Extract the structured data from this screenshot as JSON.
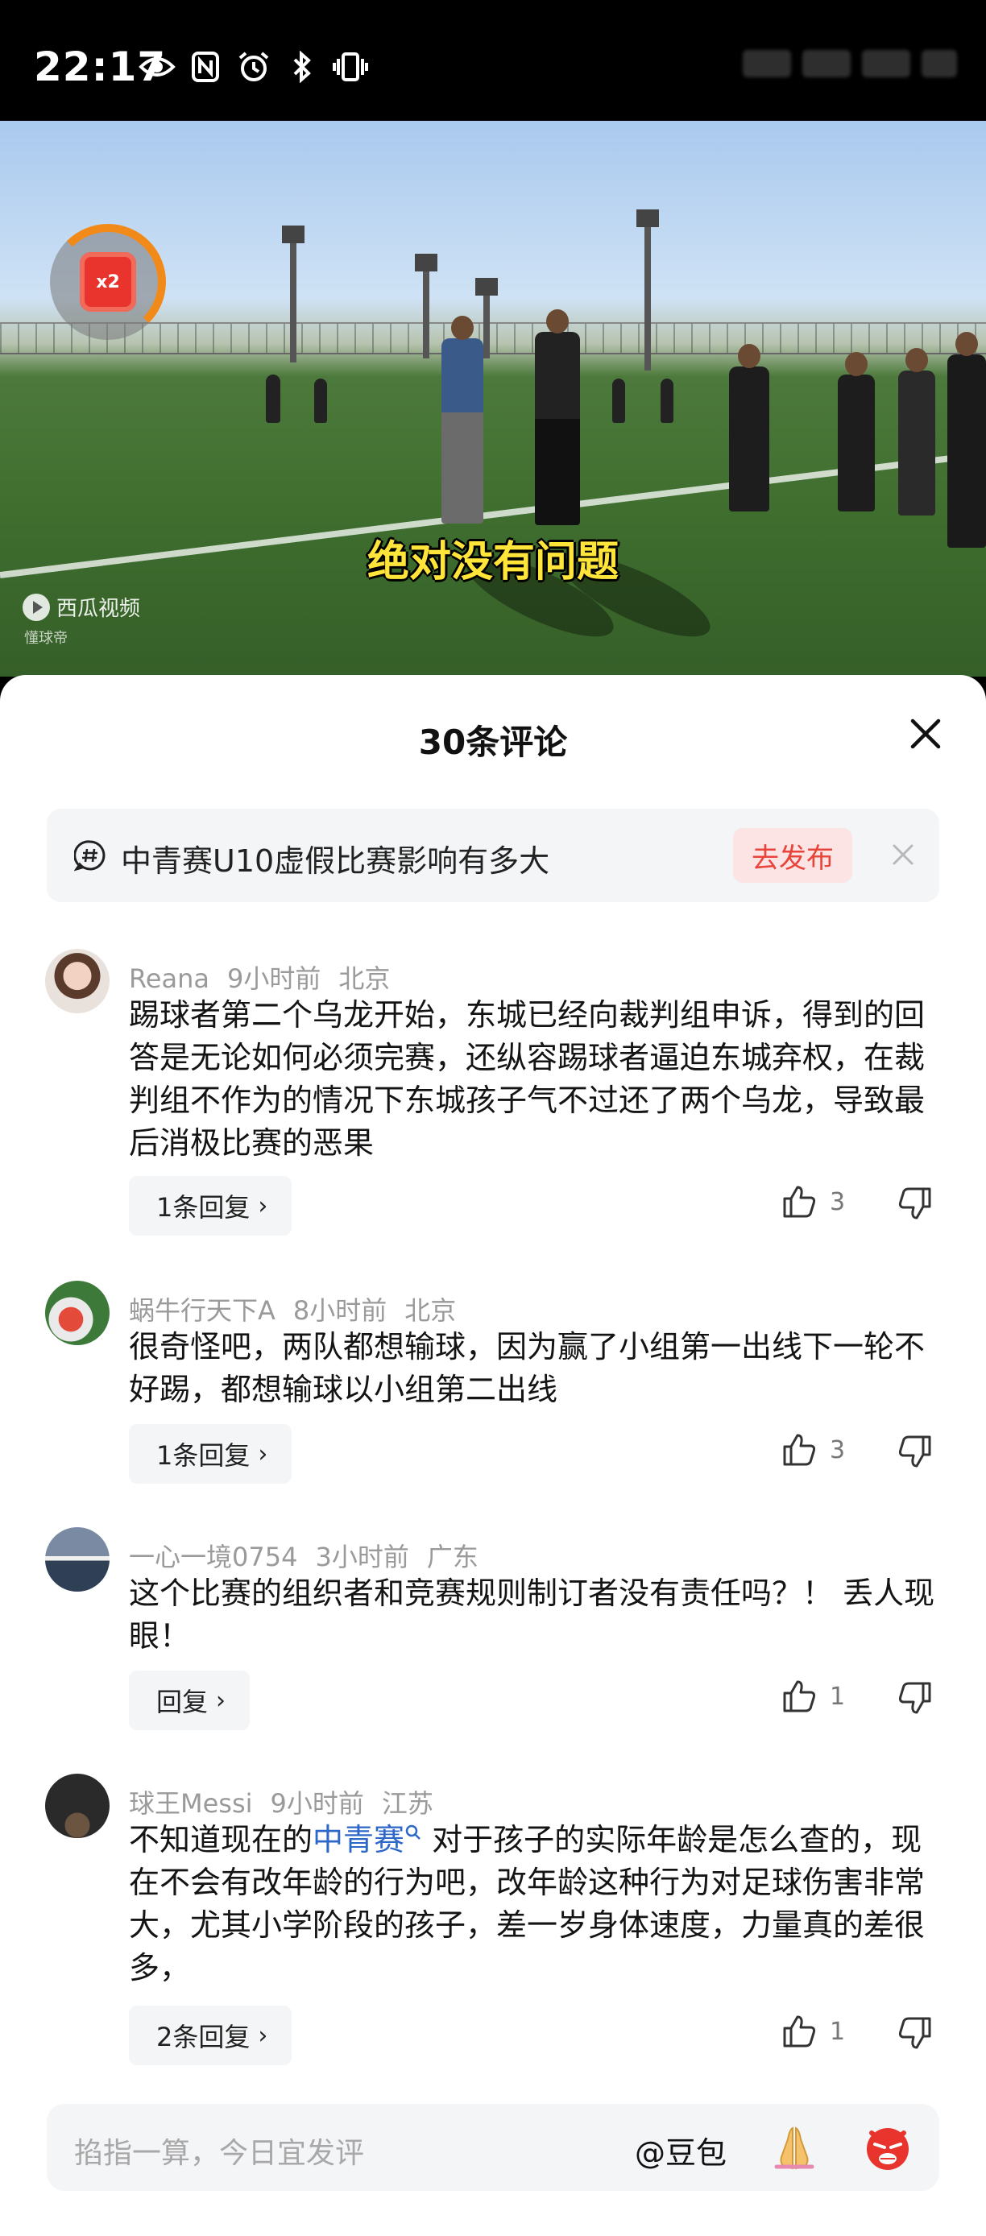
{
  "status_bar": {
    "time": "22:17"
  },
  "video": {
    "subtitle": "绝对没有问题",
    "watermark": "西瓜视频",
    "watermark_sub": "懂球帝",
    "speed_badge": "x2"
  },
  "sheet": {
    "title": "30条评论",
    "topic": {
      "text": "中青赛U10虚假比赛影响有多大",
      "publish_label": "去发布"
    },
    "comments": [
      {
        "user": "Reana",
        "time": "9小时前",
        "location": "北京",
        "text": "踢球者第二个乌龙开始，东城已经向裁判组申诉，得到的回答是无论如何必须完赛，还纵容踢球者逼迫东城弃权，在裁判组不作为的情况下东城孩子气不过还了两个乌龙，导致最后消极比赛的恶果",
        "reply_label": "1条回复",
        "likes": "3"
      },
      {
        "user": "蜗牛行天下A",
        "time": "8小时前",
        "location": "北京",
        "text": "很奇怪吧，两队都想输球，因为赢了小组第一出线下一轮不好踢，都想输球以小组第二出线",
        "reply_label": "1条回复",
        "likes": "3"
      },
      {
        "user": "一心一境0754",
        "time": "3小时前",
        "location": "广东",
        "text": "这个比赛的组织者和竞赛规则制订者没有责任吗？！ 丢人现眼！",
        "reply_label": "回复",
        "likes": "1"
      },
      {
        "user": "球王Messi",
        "time": "9小时前",
        "location": "江苏",
        "text_before": "不知道现在的",
        "text_link": "中青赛",
        "text_after": " 对于孩子的实际年龄是怎么查的，现在不会有改年龄的行为吧，改年龄这种行为对足球伤害非常大，尤其小学阶段的孩子，差一岁身体速度，力量真的差很多，",
        "reply_label": "2条回复",
        "likes": "1"
      }
    ]
  },
  "input_bar": {
    "placeholder": "掐指一算，今日宜发评",
    "at_label": "@豆包"
  },
  "colors": {
    "accent_red": "#e8443a",
    "link_blue": "#2d67c8",
    "publish_bg": "#fde4e4"
  },
  "icons": [
    "eye-icon",
    "nfc-icon",
    "alarm-icon",
    "bluetooth-icon",
    "vibrate-icon",
    "hashtag-icon",
    "close-icon",
    "thumbs-up-icon",
    "thumbs-down-icon",
    "chevron-right-icon",
    "search-icon",
    "pray-emoji-icon",
    "angry-emoji-icon"
  ]
}
